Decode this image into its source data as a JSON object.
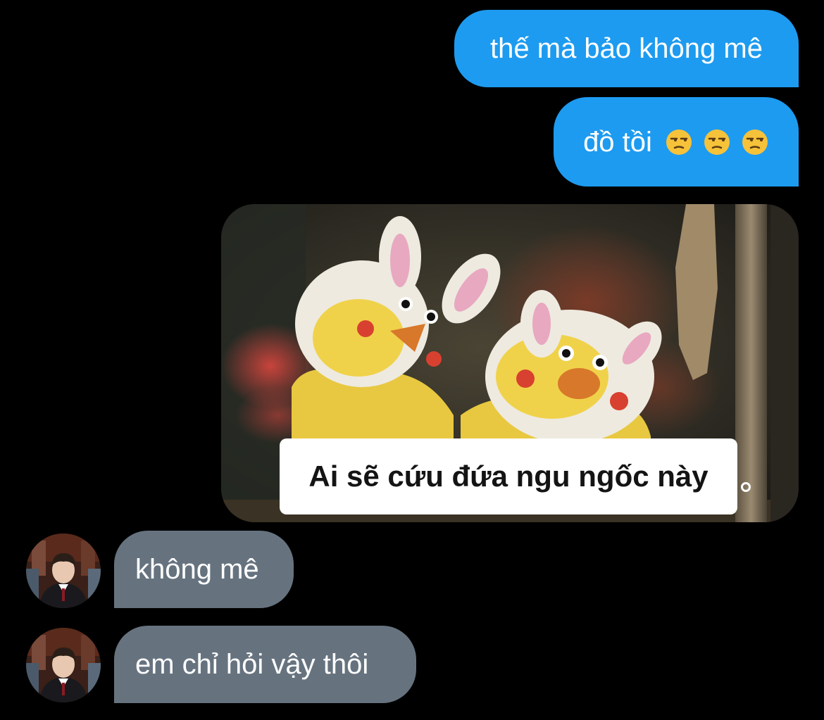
{
  "messages": {
    "out_1": {
      "text": "thế mà bảo không mê"
    },
    "out_2": {
      "text": "đồ tồi",
      "emojis": [
        "unamused-face",
        "unamused-face",
        "unamused-face"
      ]
    },
    "media": {
      "caption": "Ai sẽ cứu đứa ngu ngốc này"
    },
    "in_1": {
      "text": "không mê"
    },
    "in_2": {
      "text": "em chỉ hỏi vậy thôi"
    }
  },
  "colors": {
    "background": "#000000",
    "outgoing_bubble": "#1d9bf0",
    "incoming_bubble": "#66737f",
    "text": "#ffffff"
  }
}
